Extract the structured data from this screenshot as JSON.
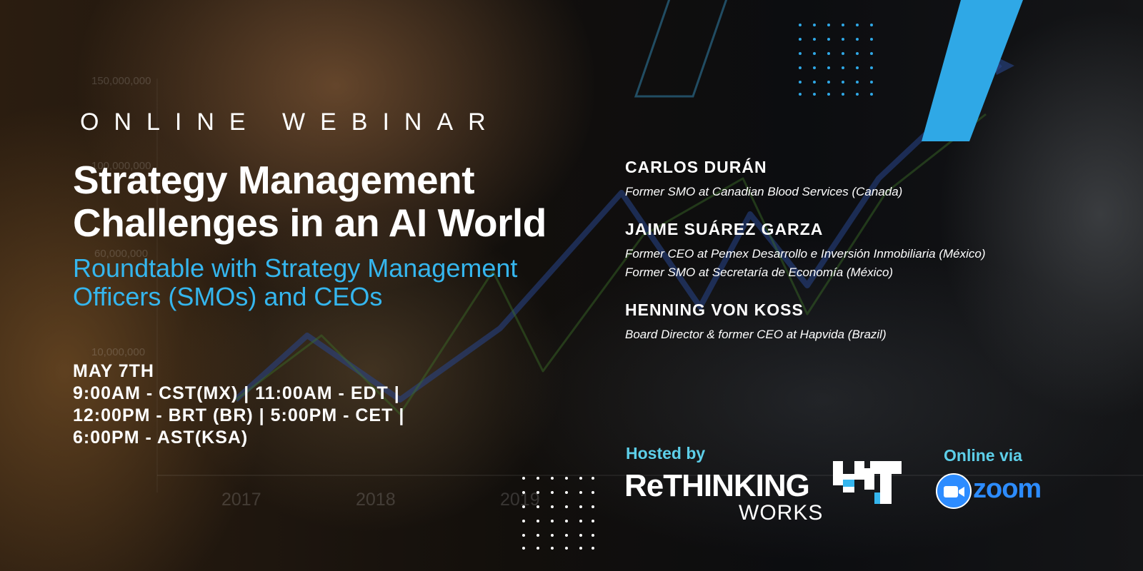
{
  "event": {
    "kicker": "ONLINE WEBINAR",
    "title_line1": "Strategy Management",
    "title_line2": "Challenges in an AI World",
    "subtitle_line1": "Roundtable with Strategy Management",
    "subtitle_line2": "Officers (SMOs) and CEOs"
  },
  "schedule": {
    "date": "MAY 7TH",
    "line1": "9:00AM - CST(MX) | 11:00AM - EDT |",
    "line2": "12:00PM - BRT (BR) | 5:00PM - CET |",
    "line3": "6:00PM - AST(KSA)"
  },
  "speakers": [
    {
      "name": "CARLOS DURÁN",
      "roles": [
        "Former SMO at Canadian Blood Services (Canada)"
      ]
    },
    {
      "name": "JAIME SUÁREZ GARZA",
      "roles": [
        "Former CEO at Pemex Desarrollo e Inversión Inmobiliaria (México)",
        "Former SMO at Secretaría de Economía (México)"
      ]
    },
    {
      "name": "HENNING VON KOSS",
      "roles": [
        "Board Director & former CEO at Hapvida (Brazil)"
      ]
    }
  ],
  "host": {
    "label": "Hosted by",
    "logo_main": "ReTHINKING",
    "logo_sub": "WORKS"
  },
  "platform": {
    "label": "Online via",
    "name": "zoom"
  },
  "background_chart": {
    "y_labels": [
      "150,000,000",
      "100,000,000",
      "60,000,000",
      "10,000,000"
    ],
    "x_labels": [
      "2017",
      "2018",
      "2019"
    ]
  },
  "colors": {
    "accent_blue": "#35b6ee",
    "label_cyan": "#5dcfe9",
    "zoom_blue": "#2d8cff"
  },
  "icons": [
    "rethinking-works-logo-icon",
    "zoom-camera-icon"
  ]
}
